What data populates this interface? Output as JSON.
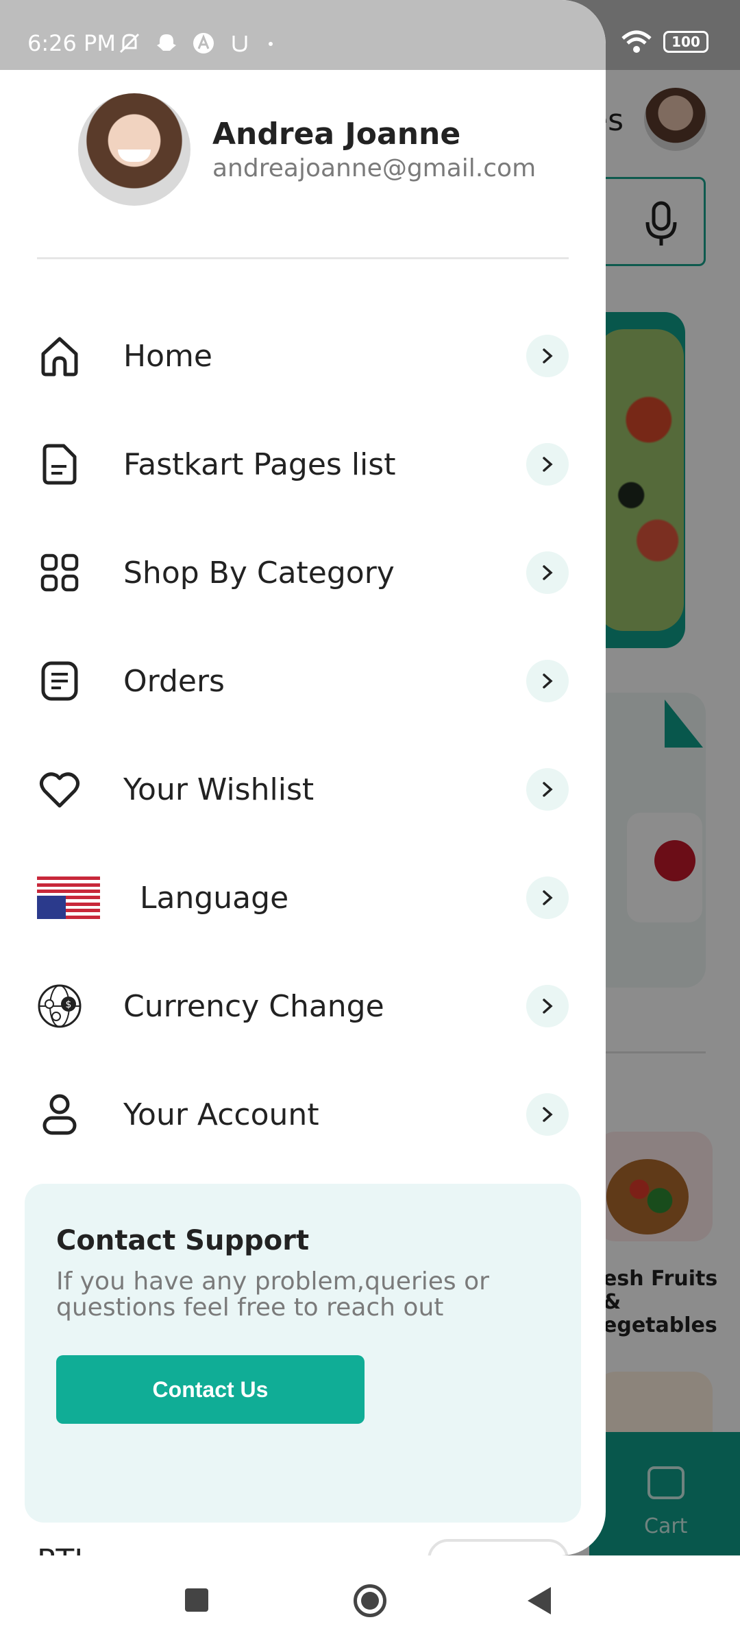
{
  "status_bar": {
    "time": "6:26 PM",
    "left_icons": [
      "mute-icon",
      "snapchat-icon",
      "app-icon",
      "u-icon",
      "dot-icon"
    ],
    "battery": "100"
  },
  "background": {
    "header_partial": "es",
    "cart_label": "Cart",
    "category_label_line1": "esh Fruits &",
    "category_label_line2": "egetables"
  },
  "drawer": {
    "profile": {
      "name": "Andrea Joanne",
      "email": "andreajoanne@gmail.com"
    },
    "menu": [
      {
        "label": "Home",
        "icon": "home-icon"
      },
      {
        "label": "Fastkart Pages list",
        "icon": "document-icon"
      },
      {
        "label": "Shop By Category",
        "icon": "grid-icon"
      },
      {
        "label": "Orders",
        "icon": "orders-icon"
      },
      {
        "label": "Your Wishlist",
        "icon": "heart-icon"
      },
      {
        "label": "Language",
        "icon": "us-flag-icon"
      },
      {
        "label": "Currency Change",
        "icon": "currency-globe-icon"
      },
      {
        "label": "Your Account",
        "icon": "user-icon"
      }
    ],
    "support": {
      "title": "Contact Support",
      "text": "If you have any problem,queries or questions feel free to reach out",
      "button": "Contact Us"
    },
    "rtl_label": "RTL"
  },
  "colors": {
    "accent": "#10ad96",
    "support_bg": "#eaf6f6",
    "arrow_bg": "#eaf6f4"
  }
}
